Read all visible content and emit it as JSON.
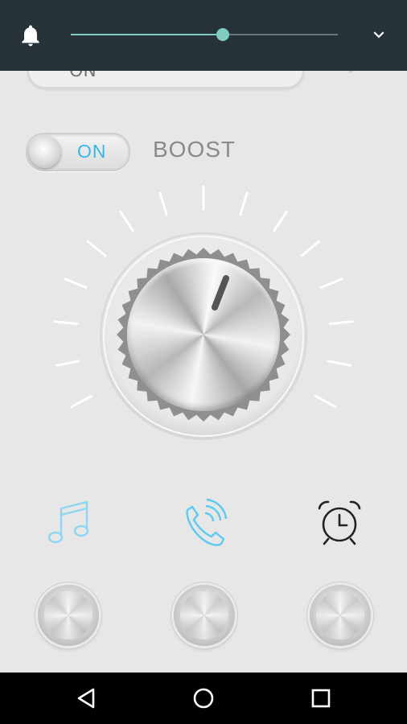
{
  "volume_panel": {
    "bell_icon": "bell-icon",
    "slider_value_fraction": 0.57,
    "expand_icon": "chevron-down-icon",
    "track_color": "#6b7478",
    "accent_color": "#80cbc4"
  },
  "previous_card": {
    "label": "ON"
  },
  "boost": {
    "toggle_label": "ON",
    "label": "BOOST",
    "accent_color": "#36b9e6"
  },
  "dial": {
    "knob_icon": "volume-knob"
  },
  "categories": [
    {
      "name": "music",
      "icon": "music-note-icon"
    },
    {
      "name": "call",
      "icon": "phone-call-icon"
    },
    {
      "name": "alarm",
      "icon": "alarm-clock-icon"
    }
  ],
  "navbar": {
    "back_icon": "back-triangle-icon",
    "home_icon": "home-circle-icon",
    "recents_icon": "recents-square-icon"
  }
}
